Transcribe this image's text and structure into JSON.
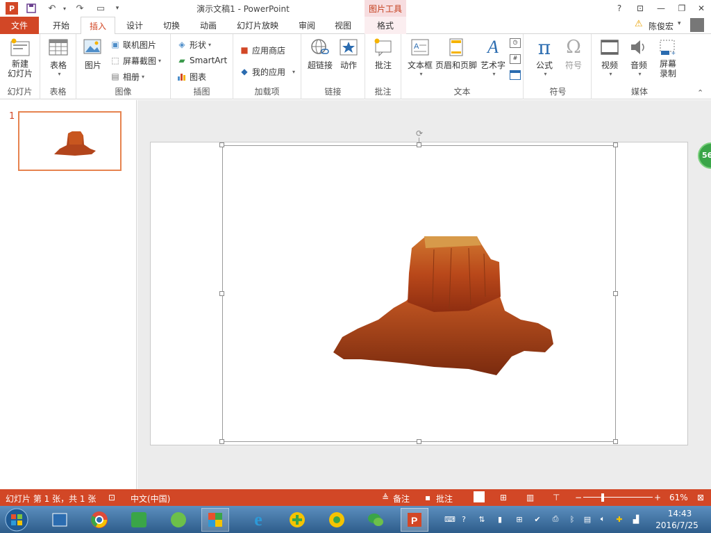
{
  "window": {
    "title": "演示文稿1 - PowerPoint",
    "picture_tools": "图片工具"
  },
  "tabs": [
    {
      "label": "文件"
    },
    {
      "label": "开始"
    },
    {
      "label": "插入"
    },
    {
      "label": "设计"
    },
    {
      "label": "切换"
    },
    {
      "label": "动画"
    },
    {
      "label": "幻灯片放映"
    },
    {
      "label": "审阅"
    },
    {
      "label": "视图"
    },
    {
      "label": "格式"
    }
  ],
  "user": {
    "name": "陈俊宏"
  },
  "ribbon": {
    "slides": {
      "new_slide": "新建\n幻灯片",
      "label": "幻灯片"
    },
    "tables": {
      "table": "表格",
      "label": "表格"
    },
    "images": {
      "picture": "图片",
      "online": "联机图片",
      "screenshot": "屏幕截图",
      "album": "相册",
      "label": "图像"
    },
    "illustrations": {
      "shapes": "形状",
      "smartart": "SmartArt",
      "chart": "图表",
      "label": "插图"
    },
    "addins": {
      "store": "应用商店",
      "my_apps": "我的应用",
      "label": "加载项"
    },
    "links": {
      "hyperlink": "超链接",
      "action": "动作",
      "label": "链接"
    },
    "comments": {
      "comment": "批注",
      "label": "批注"
    },
    "text": {
      "textbox": "文本框",
      "header_footer": "页眉和页脚",
      "wordart": "艺术字",
      "label": "文本"
    },
    "symbols": {
      "equation": "公式",
      "symbol": "符号",
      "label": "符号"
    },
    "media": {
      "video": "视频",
      "audio": "音频",
      "screen_rec": "屏幕\n录制",
      "label": "媒体"
    }
  },
  "thumbnail": {
    "number": "1"
  },
  "badge": "56",
  "status": {
    "slide_info": "幻灯片 第 1 张，共 1 张",
    "language": "中文(中国)",
    "notes": "备注",
    "comments": "批注",
    "zoom": "61%"
  },
  "taskbar": {
    "time": "14:43",
    "date": "2016/7/25"
  },
  "colors": {
    "accent": "#d24726",
    "taskbar": "#2d5c8a"
  }
}
